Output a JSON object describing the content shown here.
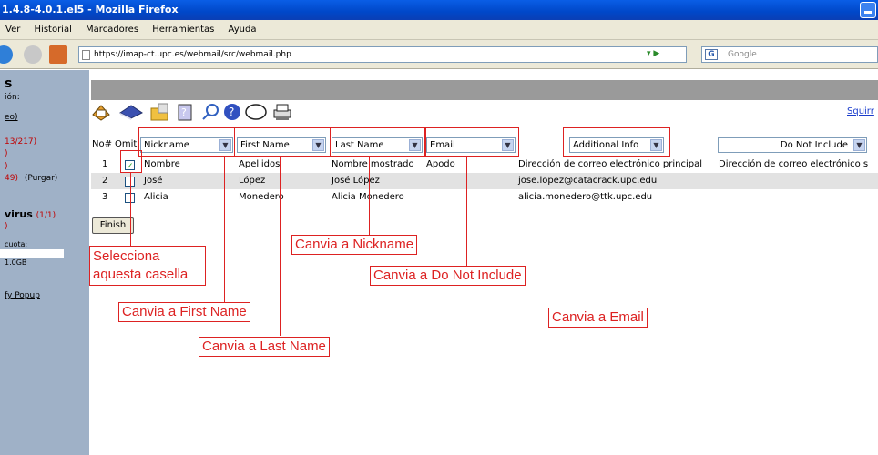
{
  "window": {
    "title": "1.4.8-4.0.1.el5 - Mozilla Firefox"
  },
  "menu": [
    "Ver",
    "Historial",
    "Marcadores",
    "Herramientas",
    "Ayuda"
  ],
  "nav": {
    "url": "https://imap-ct.upc.es/webmail/src/webmail.php",
    "search_placeholder": "Google"
  },
  "sidebar": {
    "title": "s",
    "subtitle": "ión:",
    "link1": "eo)",
    "count1": "13/217)",
    "count2": ")",
    "count3": ")",
    "purge_count": "49)",
    "purge_label": "(Purgar)",
    "virus_label": "virus",
    "virus_count": "(1/1)",
    "virus_sub": ")",
    "quota_label": "cuota:",
    "quota_value": "1.0GB",
    "popup_link": "fy Popup"
  },
  "toolbar": {
    "squirrel_link": "Squirr"
  },
  "table": {
    "headers": {
      "no": "No#",
      "omit": "Omit"
    },
    "selects": [
      "Nickname",
      "First Name",
      "Last Name",
      "Email",
      "Additional Info",
      "Do Not Include"
    ],
    "rows": [
      {
        "no": "1",
        "checked": true,
        "c1": "Nombre",
        "c2": "Apellidos",
        "c3": "Nombre mostrado",
        "c4": "Apodo",
        "c5": "Dirección de correo electrónico principal",
        "c6": "Dirección de correo electrónico s"
      },
      {
        "no": "2",
        "checked": false,
        "c1": "José",
        "c2": "López",
        "c3": "José López",
        "c4": "",
        "c5": "jose.lopez@catacrack.upc.edu",
        "c6": ""
      },
      {
        "no": "3",
        "checked": false,
        "c1": "Alicia",
        "c2": "Monedero",
        "c3": "Alicia Monedero",
        "c4": "",
        "c5": "alicia.monedero@ttk.upc.edu",
        "c6": ""
      }
    ],
    "finish_label": "Finish"
  },
  "annotations": {
    "select_box_line1": "Selecciona",
    "select_box_line2": "aquesta casella",
    "first_name": "Canvia a First Name",
    "last_name": "Canvia a Last Name",
    "nickname": "Canvia a Nickname",
    "do_not_include": "Canvia a Do Not Include",
    "email": "Canvia a Email"
  },
  "colors": {
    "annotation": "#dd2222",
    "sidebar": "#9fb1c7",
    "titlebar": "#0047c8",
    "link": "#1a3ccc"
  }
}
